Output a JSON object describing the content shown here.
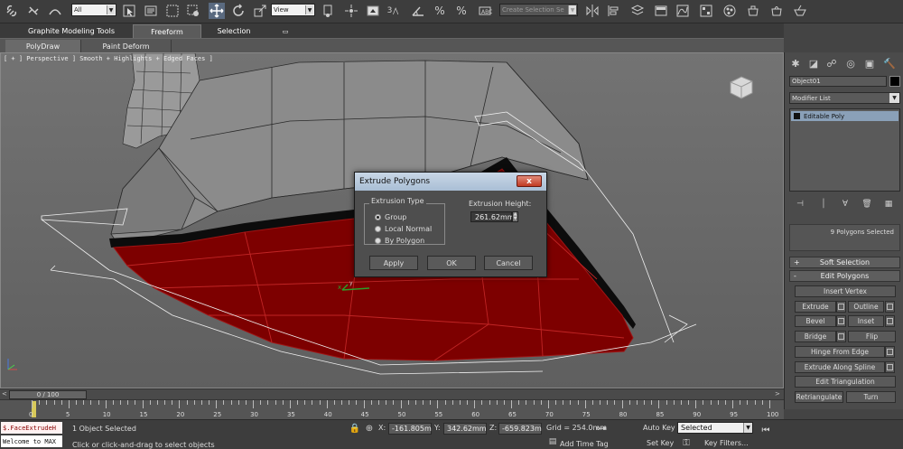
{
  "toolbar": {
    "selection_filter": "All",
    "reference_coord": "View",
    "named_selection": "Create Selection Se",
    "snap_value": "3",
    "snap_value_2": "%",
    "snap_value_3": "%",
    "icons": [
      "link-icon",
      "unlink-icon",
      "bind-spacewarp-icon",
      "filter-select",
      "select-object-icon",
      "select-by-name-icon",
      "rect-selection-icon",
      "window-crossing-icon",
      "move-icon",
      "rotate-icon",
      "scale-icon",
      "reference-coord",
      "pivot-icon",
      "manipulate-icon",
      "keyboard-shortcut-icon",
      "snap-toggle-icon",
      "angle-snap-icon",
      "percent-snap-icon",
      "spinner-snap-icon",
      "edit-named-sel-icon",
      "named-selection",
      "mirror-icon",
      "align-icon",
      "layer-manager-icon",
      "graphite-toggle-icon",
      "curve-editor-icon",
      "schematic-icon",
      "material-editor-icon",
      "render-setup-icon",
      "render-frame-icon",
      "render-icon"
    ]
  },
  "ribbon": {
    "tabs": [
      {
        "label": "Graphite Modeling Tools",
        "active": false
      },
      {
        "label": "Freeform",
        "active": true
      },
      {
        "label": "Selection",
        "active": false
      }
    ],
    "collapse": "▭",
    "subtabs": [
      {
        "label": "PolyDraw",
        "active": true
      },
      {
        "label": "Paint Deform",
        "active": false
      }
    ]
  },
  "viewport": {
    "label": "[ + ] Perspective ] Smooth + Highlights + Edged Faces ]",
    "background": "#6e6e6e",
    "selection_color": "#8b0000"
  },
  "dialog": {
    "title": "Extrude Polygons",
    "close": "x",
    "extrusion_type_label": "Extrusion Type",
    "options": [
      {
        "label": "Group",
        "selected": true
      },
      {
        "label": "Local Normal",
        "selected": false
      },
      {
        "label": "By Polygon",
        "selected": false
      }
    ],
    "height_label": "Extrusion Height:",
    "height_value": "261.62mm",
    "buttons": {
      "apply": "Apply",
      "ok": "OK",
      "cancel": "Cancel"
    }
  },
  "command_panel": {
    "object_name": "Object01",
    "object_color": "#000000",
    "modifier_list": "Modifier List",
    "stack_item": "Editable Poly",
    "selection_info": "9 Polygons Selected",
    "soft_selection": {
      "sign": "+",
      "label": "Soft Selection"
    },
    "edit_polygons": {
      "sign": "-",
      "label": "Edit Polygons"
    },
    "buttons": {
      "insert_vertex": "Insert Vertex",
      "extrude": "Extrude",
      "outline": "Outline",
      "bevel": "Bevel",
      "inset": "Inset",
      "bridge": "Bridge",
      "flip": "Flip",
      "hinge_from_edge": "Hinge From Edge",
      "extrude_along_spline": "Extrude Along Spline",
      "edit_triangulation": "Edit Triangulation",
      "retriangulate": "Retriangulate",
      "turn": "Turn"
    }
  },
  "time_slider": {
    "frame": "0 / 100",
    "left": "<",
    "right": ">",
    "ticks": [
      "0",
      "5",
      "10",
      "15",
      "20",
      "25",
      "30",
      "35",
      "40",
      "45",
      "50",
      "55",
      "60",
      "65",
      "70",
      "75",
      "80",
      "85",
      "90",
      "95",
      "100"
    ],
    "current_frame": 0
  },
  "status_bar": {
    "maxscript_line1": "$.FaceExtrudeH",
    "maxscript_line2": "Welcome to MAX",
    "objects_selected": "1 Object Selected",
    "prompt": "Click or click-and-drag to select objects",
    "x_label": "X:",
    "x_value": "-161.805m",
    "y_label": "Y:",
    "y_value": "342.62mm",
    "z_label": "Z:",
    "z_value": "-659.823m",
    "grid": "Grid = 254.0mm",
    "auto_key": "Auto Key",
    "set_key": "Set Key",
    "key_mode": "Selected",
    "key_filters": "Key Filters...",
    "add_time_tag": "Add Time Tag"
  }
}
